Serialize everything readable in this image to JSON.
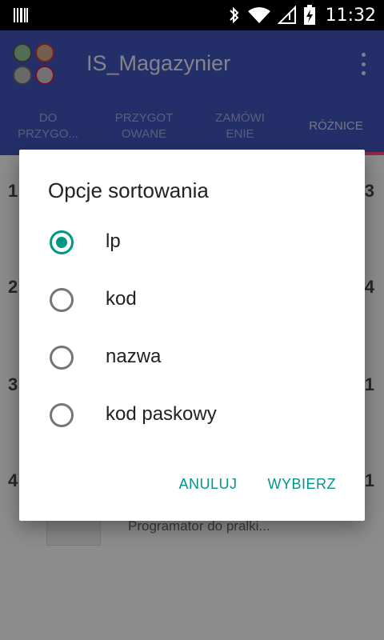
{
  "status_bar": {
    "time": "11:32",
    "icons": [
      "barcode-icon",
      "bluetooth-icon",
      "wifi-icon",
      "signal-icon",
      "battery-charging-icon"
    ]
  },
  "app_bar": {
    "title": "IS_Magazynier",
    "logo": "app-logo"
  },
  "tabs": [
    {
      "label": "DO\nPRZYGO..."
    },
    {
      "label": "PRZYGOT\nOWANE"
    },
    {
      "label": "ZAMÓWI\nENIE"
    },
    {
      "label": "RÓŻNICE"
    }
  ],
  "background_list": {
    "rows": [
      {
        "left": "1",
        "right": "3"
      },
      {
        "left": "2",
        "right": "4"
      },
      {
        "left": "3",
        "right": "1"
      },
      {
        "left": "4",
        "right": "1"
      }
    ],
    "last_description": "Programator do pralki..."
  },
  "dialog": {
    "title": "Opcje sortowania",
    "options": [
      {
        "label": "lp",
        "selected": true
      },
      {
        "label": "kod",
        "selected": false
      },
      {
        "label": "nazwa",
        "selected": false
      },
      {
        "label": "kod paskowy",
        "selected": false
      }
    ],
    "cancel_label": "ANULUJ",
    "confirm_label": "WYBIERZ"
  },
  "colors": {
    "primary": "#3f51b5",
    "accent": "#009688",
    "tab_indicator": "#ff4081"
  }
}
